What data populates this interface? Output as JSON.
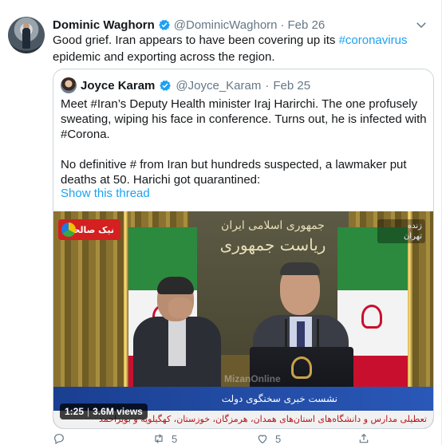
{
  "tweet": {
    "author_name": "Dominic Waghorn",
    "author_handle": "@DominicWaghorn",
    "separator": "·",
    "date": "Feb 26",
    "text_before": "Good grief.  Iran appears to have been covering up its ",
    "hashtag": "#coronavirus",
    "text_after": " epidemic and exporting across the region.",
    "verified_icon": "verified-badge-icon",
    "menu_icon": "chevron-down-icon"
  },
  "quote": {
    "author_name": "Joyce Karam",
    "author_handle": "@Joyce_Karam",
    "separator": "·",
    "date": "Feb 25",
    "paragraph1": "Meet #Iran’s Deputy Health minister  Iraj Harirchi. The one profusely sweating, wiping his face in  conference. Turns out, he is infected with #Corona.",
    "paragraph2": "No definitive # from Iran but hundreds suspected, a lawmaker put deaths at 50. Harichi got quarantined:",
    "show_thread": "Show this thread"
  },
  "video": {
    "live_badge": "نیک صالحی",
    "tv_line1": "زنده",
    "tv_line2": "تهران",
    "wall_line1": "جمهوری اسلامی ایران",
    "wall_line2": "ریاست جمهوری",
    "lower_title": "نشست خبری سخنگوی دولت",
    "ticker": "تعطیلی مدارس و دانشگاه‌های استان‌های همدان، هرمزگان، خوزستان، کهگیلویه و بویراحمد",
    "watermark": "MizanOnline",
    "duration": "1:25",
    "views": "3.6M views",
    "duration_separator": "|"
  },
  "actions": {
    "reply_icon": "reply-icon",
    "reply_count": "",
    "retweet_icon": "retweet-icon",
    "retweet_count": "5",
    "like_icon": "heart-icon",
    "like_count": "5",
    "share_icon": "share-icon"
  },
  "colors": {
    "link": "#1da1f2",
    "text": "#14171a",
    "muted": "#657786",
    "border": "#ccd6dd"
  }
}
